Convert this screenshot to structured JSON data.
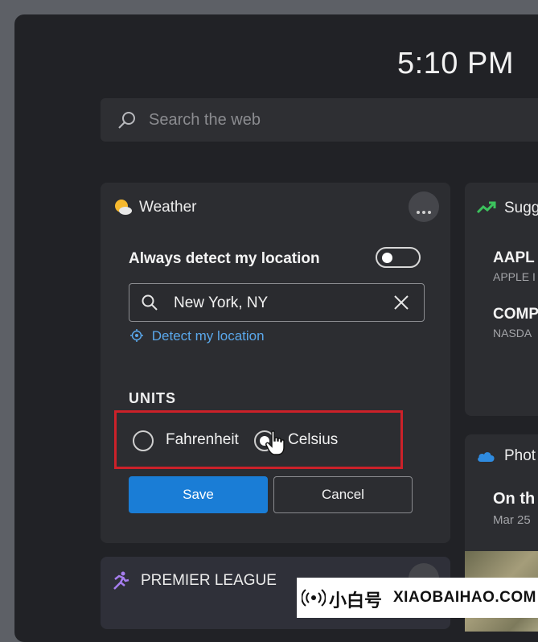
{
  "header": {
    "time": "5:10 PM"
  },
  "search": {
    "placeholder": "Search the web"
  },
  "weather": {
    "title": "Weather",
    "always_detect_label": "Always detect my location",
    "always_detect_on": false,
    "location_value": "New York, NY",
    "detect_link": "Detect my location",
    "units_label": "UNITS",
    "options": [
      "Fahrenheit",
      "Celsius"
    ],
    "selected_option": "Celsius",
    "save_label": "Save",
    "cancel_label": "Cancel"
  },
  "stocks": {
    "title": "Sugg",
    "items": [
      {
        "symbol": "AAPL",
        "name": "APPLE I"
      },
      {
        "symbol": "COMP",
        "name": "NASDA"
      }
    ]
  },
  "photos": {
    "title": "Phot",
    "headline": "On th",
    "date": "Mar 25"
  },
  "sports": {
    "title": "PREMIER LEAGUE"
  },
  "watermark": {
    "cn": "小白号",
    "en": "XIAOBAIHAO.COM"
  },
  "colors": {
    "accent": "#1a7dd6",
    "highlight": "#cc2129",
    "link": "#5aa7ea"
  }
}
